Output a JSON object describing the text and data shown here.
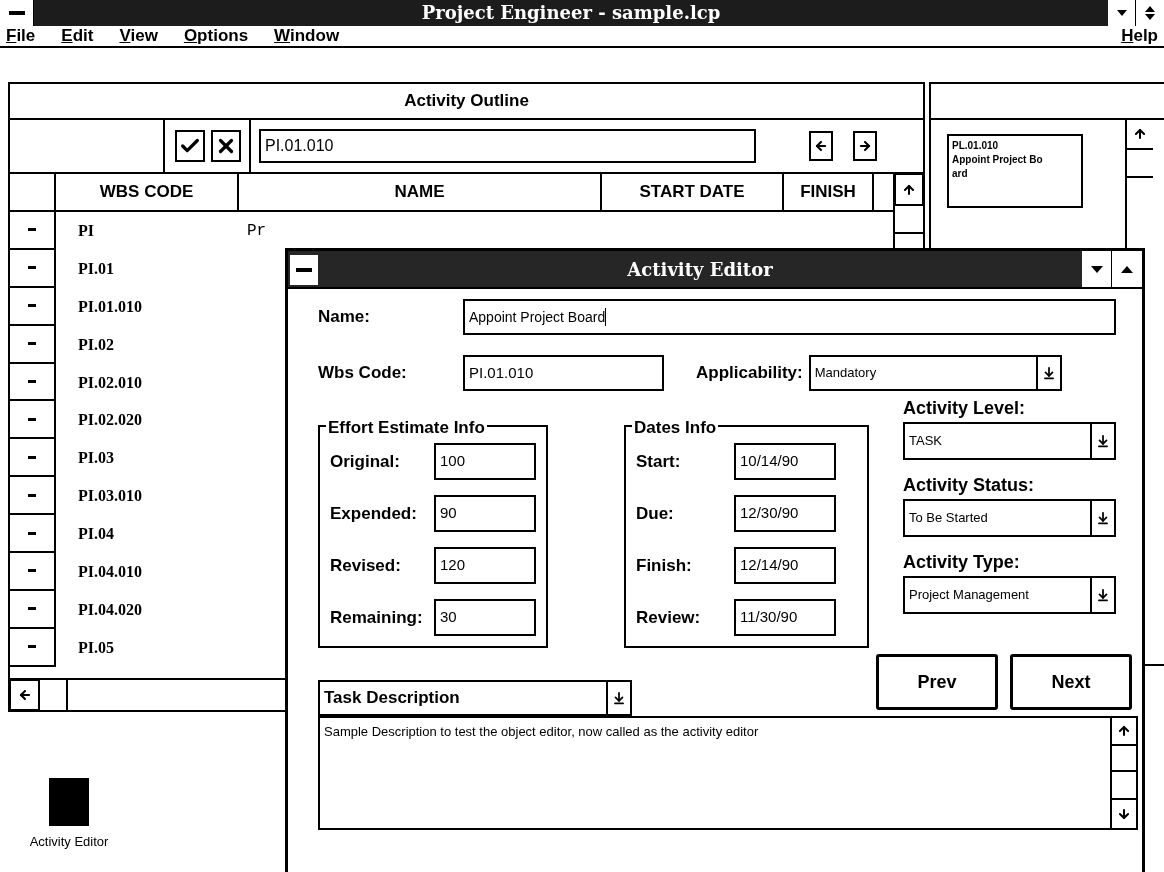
{
  "window": {
    "title": "Project Engineer - sample.lcp"
  },
  "menu": [
    {
      "label": "File"
    },
    {
      "label": "Edit"
    },
    {
      "label": "View"
    },
    {
      "label": "Options"
    },
    {
      "label": "Window"
    },
    {
      "label": "Help"
    }
  ],
  "outline": {
    "title": "Activity Outline",
    "code_field": "PI.01.010",
    "columns": [
      "WBS CODE",
      "NAME",
      "START DATE",
      "FINISH"
    ],
    "rows": [
      {
        "wbs": "PI",
        "name": "Pr"
      },
      {
        "wbs": "PI.01"
      },
      {
        "wbs": "PI.01.010"
      },
      {
        "wbs": "PI.02"
      },
      {
        "wbs": "PI.02.010"
      },
      {
        "wbs": "PI.02.020"
      },
      {
        "wbs": "PI.03"
      },
      {
        "wbs": "PI.03.010"
      },
      {
        "wbs": "PI.04"
      },
      {
        "wbs": "PI.04.010"
      },
      {
        "wbs": "PI.04.020"
      },
      {
        "wbs": "PI.05"
      }
    ]
  },
  "diagram": {
    "node_lines": [
      "PL.01.010",
      "Appoint Project Bo",
      "ard"
    ]
  },
  "editor": {
    "title": "Activity Editor",
    "name_label": "Name:",
    "name": "Appoint Project Board",
    "wbs_label": "Wbs Code:",
    "wbs": "PI.01.010",
    "applicability_label": "Applicability:",
    "applicability": "Mandatory",
    "effort": {
      "title": "Effort Estimate Info",
      "fields": [
        {
          "label": "Original:",
          "value": "100"
        },
        {
          "label": "Expended:",
          "value": "90"
        },
        {
          "label": "Revised:",
          "value": "120"
        },
        {
          "label": "Remaining:",
          "value": "30"
        }
      ]
    },
    "dates": {
      "title": "Dates Info",
      "fields": [
        {
          "label": "Start:",
          "value": "10/14/90"
        },
        {
          "label": "Due:",
          "value": "12/30/90"
        },
        {
          "label": "Finish:",
          "value": "12/14/90"
        },
        {
          "label": "Review:",
          "value": "11/30/90"
        }
      ]
    },
    "selects": [
      {
        "label": "Activity Level:",
        "value": "TASK"
      },
      {
        "label": "Activity Status:",
        "value": "To Be Started"
      },
      {
        "label": "Activity Type:",
        "value": "Project Management"
      }
    ],
    "buttons": [
      "Prev",
      "Next"
    ],
    "description_label": "Task Description",
    "description": "Sample Description to test the object editor, now called as the activity editor"
  },
  "desktop_icon": {
    "label": "Activity Editor"
  }
}
